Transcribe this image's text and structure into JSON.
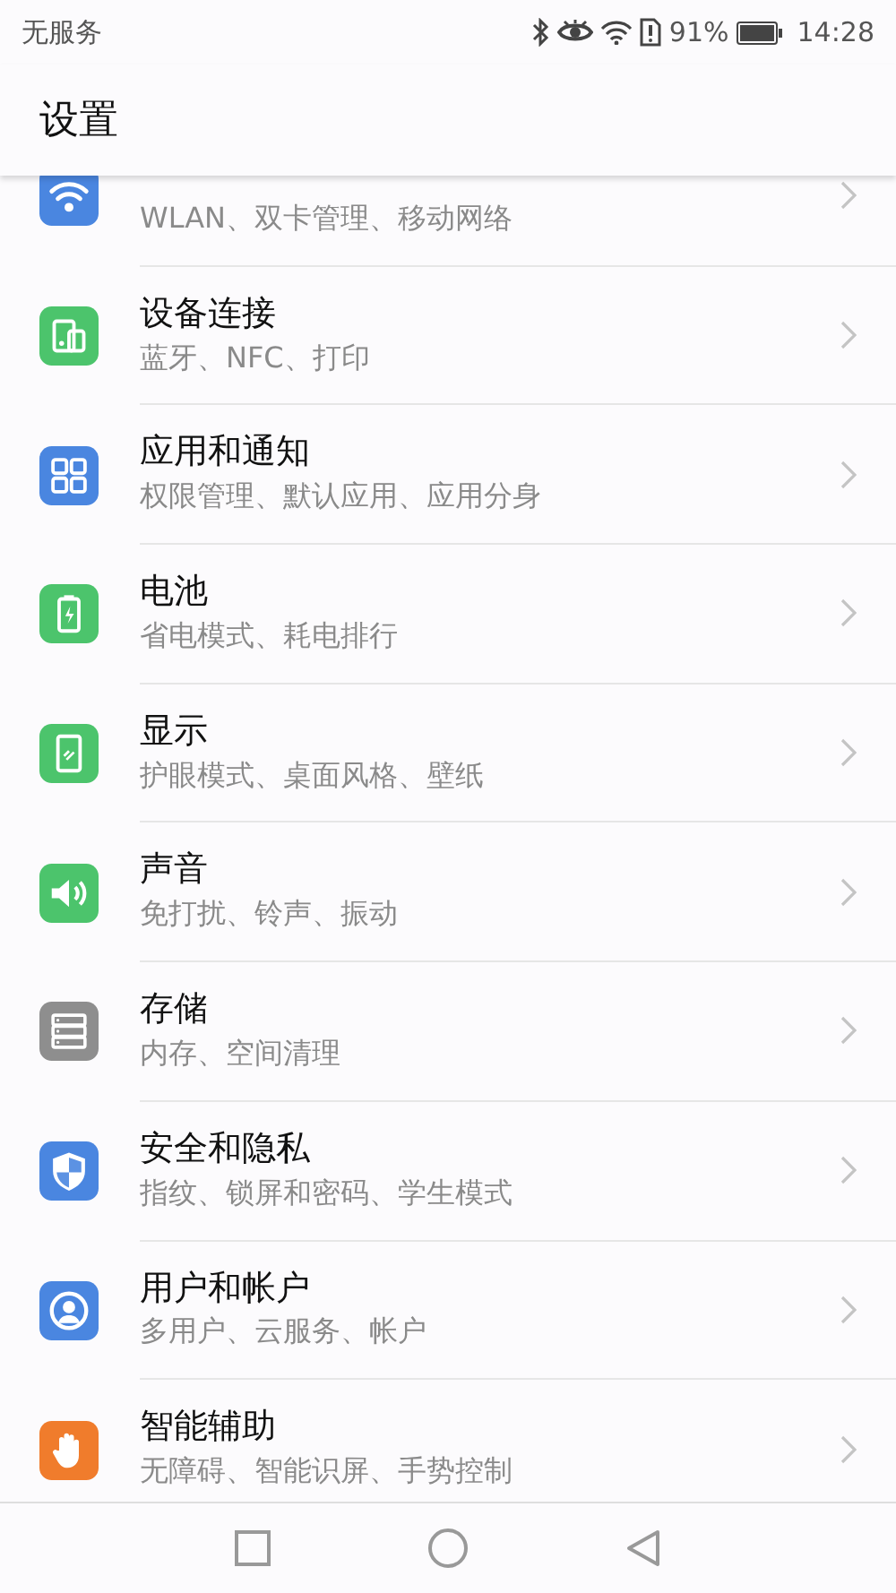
{
  "status_bar": {
    "carrier": "无服务",
    "battery_percent": "91%",
    "time": "14:28"
  },
  "header": {
    "title": "设置"
  },
  "items": [
    {
      "subtitle": "WLAN、双卡管理、移动网络",
      "color": "#4a86e0"
    },
    {
      "title": "设备连接",
      "subtitle": "蓝牙、NFC、打印",
      "color": "#4cc46c"
    },
    {
      "title": "应用和通知",
      "subtitle": "权限管理、默认应用、应用分身",
      "color": "#4a86e0"
    },
    {
      "title": "电池",
      "subtitle": "省电模式、耗电排行",
      "color": "#4cc46c"
    },
    {
      "title": "显示",
      "subtitle": "护眼模式、桌面风格、壁纸",
      "color": "#4cc46c"
    },
    {
      "title": "声音",
      "subtitle": "免打扰、铃声、振动",
      "color": "#4cc46c"
    },
    {
      "title": "存储",
      "subtitle": "内存、空间清理",
      "color": "#8e8e8e"
    },
    {
      "title": "安全和隐私",
      "subtitle": "指纹、锁屏和密码、学生模式",
      "color": "#4a86e0"
    },
    {
      "title": "用户和帐户",
      "subtitle": "多用户、云服务、帐户",
      "color": "#4a86e0"
    },
    {
      "title": "智能辅助",
      "subtitle": "无障碍、智能识屏、手势控制",
      "color": "#f07c2c"
    }
  ]
}
